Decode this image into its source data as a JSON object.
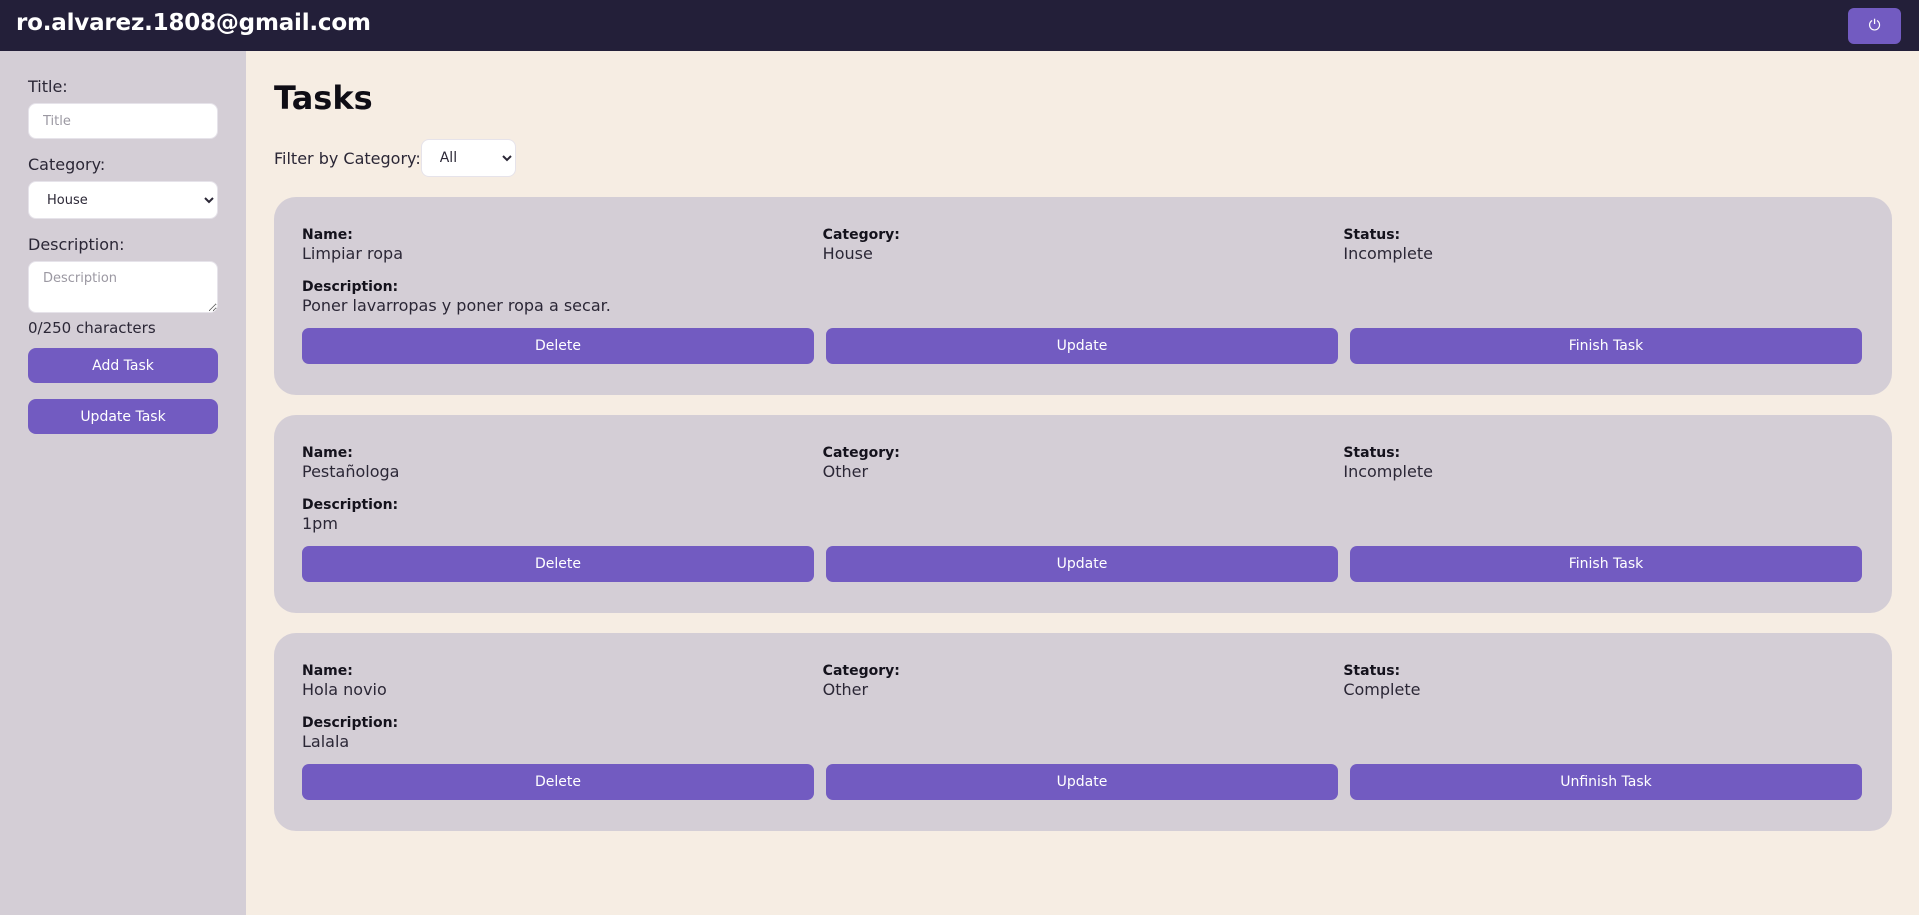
{
  "header": {
    "user_email": "ro.alvarez.1808@gmail.com",
    "logout_icon": "power-icon"
  },
  "sidebar": {
    "title_label": "Title:",
    "title_placeholder": "Title",
    "title_value": "",
    "category_label": "Category:",
    "category_value": "House",
    "description_label": "Description:",
    "description_placeholder": "Description",
    "description_value": "",
    "char_count": "0/250 characters",
    "add_button": "Add Task",
    "update_button": "Update Task"
  },
  "main": {
    "title": "Tasks",
    "filter_label": "Filter by Category:",
    "filter_value": "All",
    "labels": {
      "name": "Name:",
      "category": "Category:",
      "status": "Status:",
      "description": "Description:"
    },
    "tasks": [
      {
        "name": "Limpiar ropa",
        "category": "House",
        "status": "Incomplete",
        "description": "Poner lavarropas y poner ropa a secar.",
        "delete_label": "Delete",
        "update_label": "Update",
        "toggle_label": "Finish Task"
      },
      {
        "name": "Pestañologa",
        "category": "Other",
        "status": "Incomplete",
        "description": "1pm",
        "delete_label": "Delete",
        "update_label": "Update",
        "toggle_label": "Finish Task"
      },
      {
        "name": "Hola novio",
        "category": "Other",
        "status": "Complete",
        "description": "Lalala",
        "delete_label": "Delete",
        "update_label": "Update",
        "toggle_label": "Unfinish Task"
      }
    ]
  },
  "colors": {
    "topbar": "#231f39",
    "accent": "#725bc1",
    "sidebar": "#d4ced6",
    "page": "#f6ede3",
    "card": "#d4ced6"
  }
}
